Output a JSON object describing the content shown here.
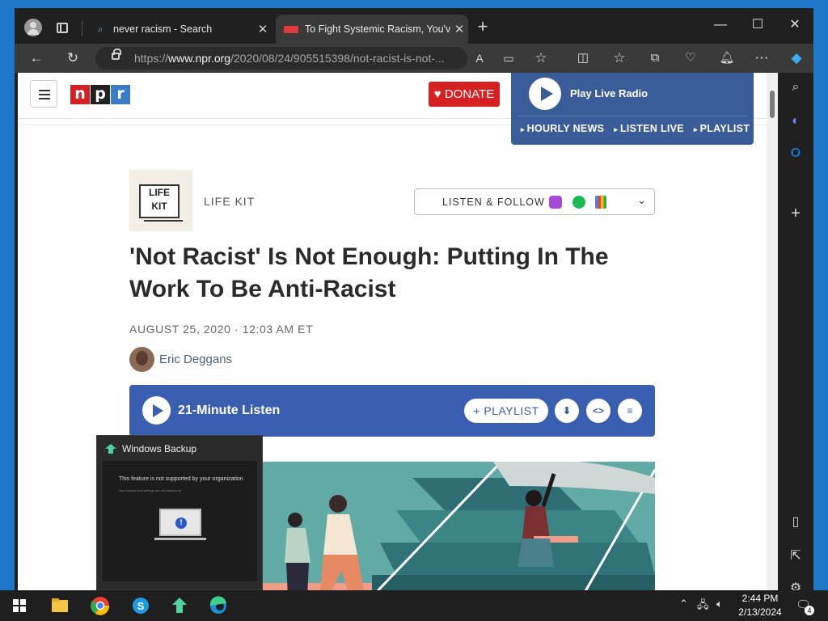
{
  "browser": {
    "tabs": [
      {
        "label": "never racism - Search",
        "favicon": "search-favicon"
      },
      {
        "label": "To Fight Systemic Racism, You've",
        "favicon": "npr-favicon"
      }
    ],
    "address": {
      "scheme": "https://",
      "domain": "www.npr.org",
      "path": "/2020/08/24/905515398/not-racist-is-not-..."
    }
  },
  "npr": {
    "logo": [
      "n",
      "p",
      "r"
    ],
    "donate_label": "DONATE",
    "radio": {
      "title": "Play Live Radio",
      "links": [
        "HOURLY NEWS",
        "LISTEN LIVE",
        "PLAYLIST"
      ]
    },
    "show": {
      "badge_line1": "LIFE",
      "badge_line2": "KIT",
      "label": "LIFE KIT",
      "listen_follow": "LISTEN & FOLLOW"
    },
    "headline": "'Not Racist' Is Not Enough: Putting In The Work To Be Anti-Racist",
    "dateline": "AUGUST 25, 2020 · 12:03 AM ET",
    "author": "Eric Deggans",
    "player": {
      "title": "21-Minute Listen",
      "playlist_label": "+ PLAYLIST"
    }
  },
  "popup": {
    "title": "Windows Backup",
    "message": "This feature is not supported by your organization",
    "sub": "Your folders and settings are not backed up"
  },
  "taskbar": {
    "time": "2:44 PM",
    "date": "2/13/2024",
    "notifications": "4"
  },
  "colors": {
    "npr_red": "#d62021",
    "npr_blue": "#3a5fb0",
    "radio_bg": "#3a5c98"
  }
}
